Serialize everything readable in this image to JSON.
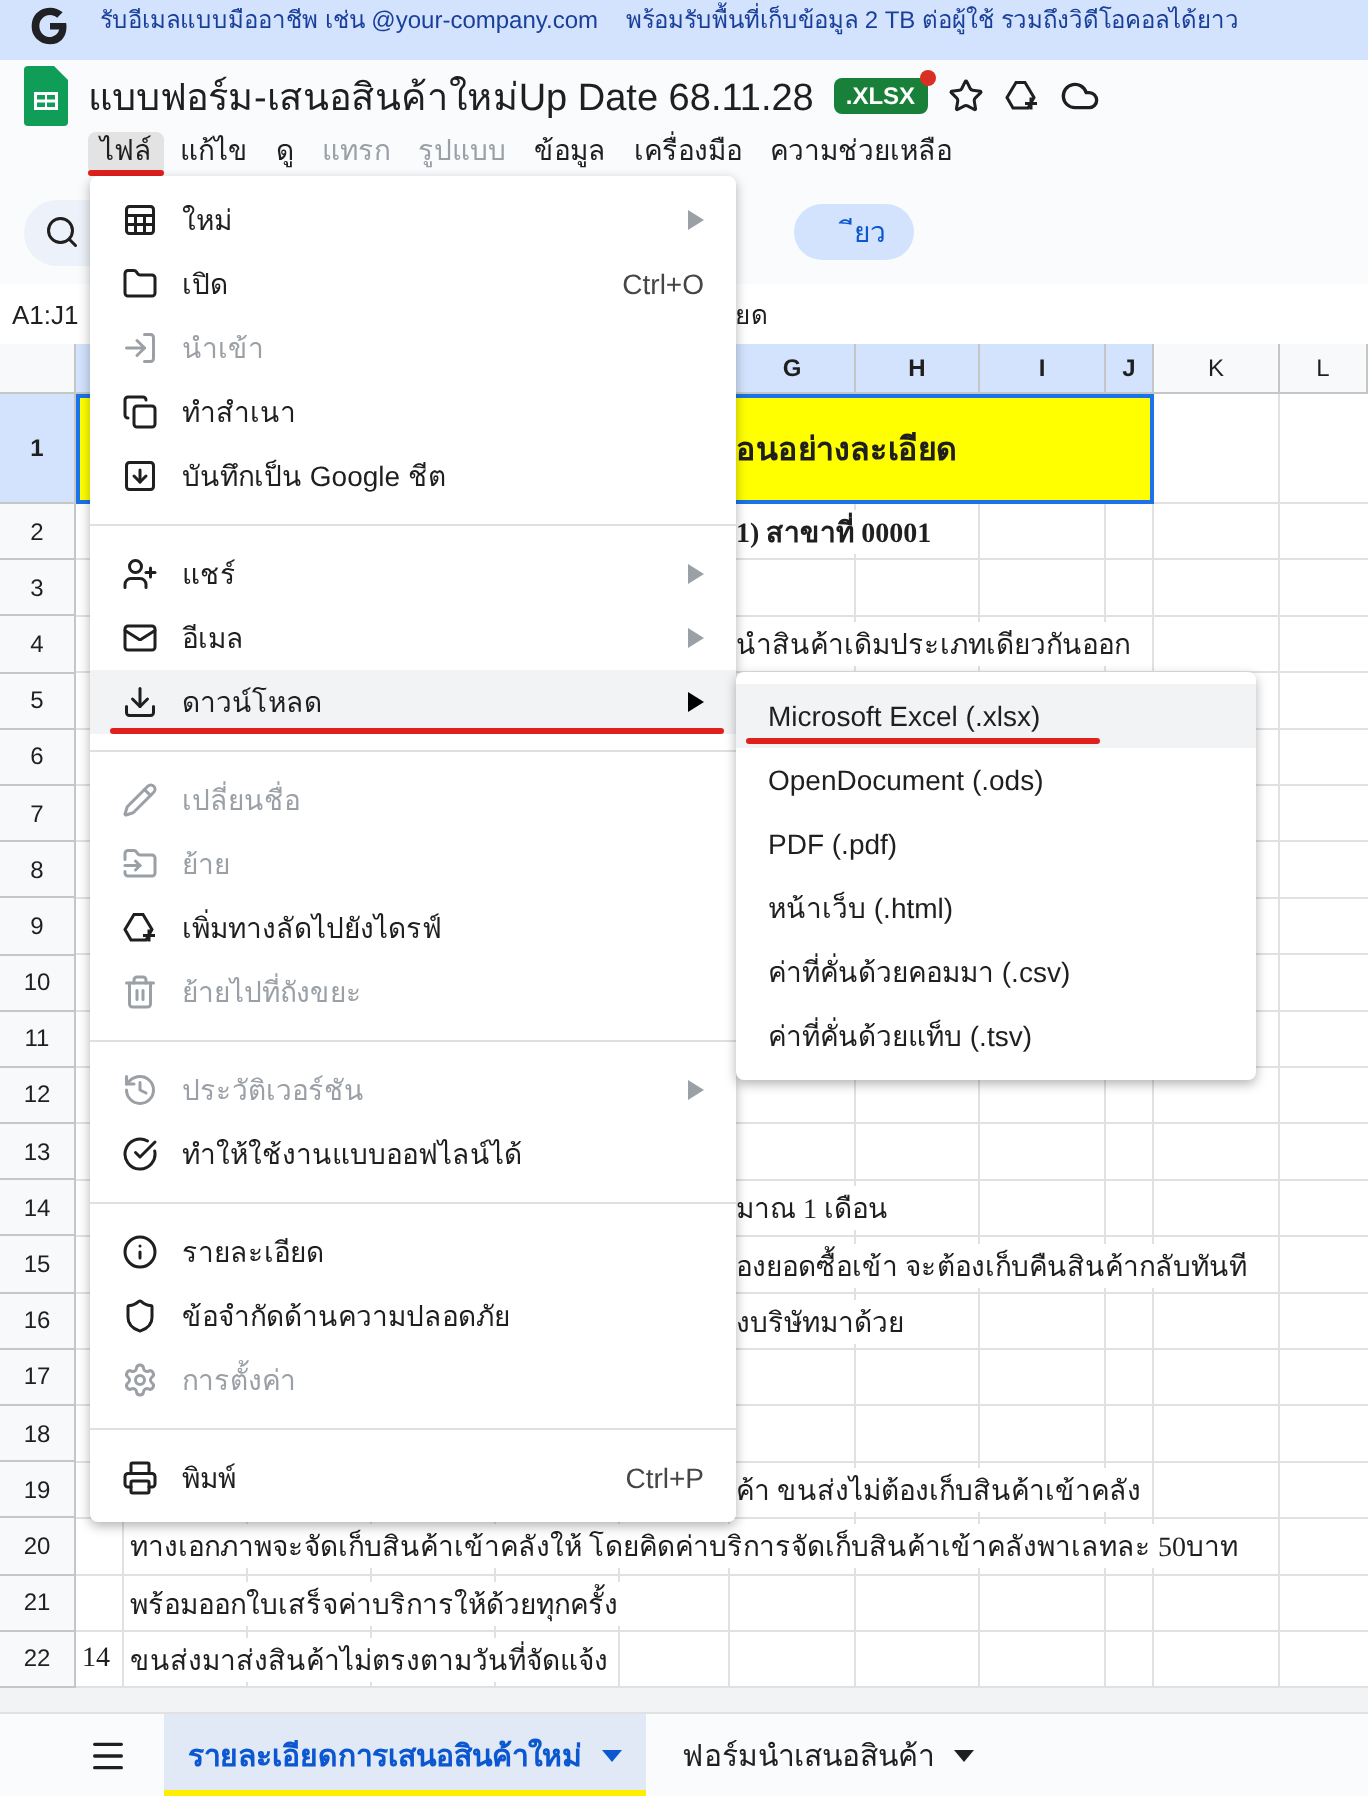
{
  "banner": {
    "texts": [
      "รับอีเมลแบบมืออาชีพ เช่น  @your-company.com",
      "พร้อมรับพื้นที่เก็บข้อมูล 2 TB ต่อผู้ใช้ รวมถึงวิดีโอคอลได้ยาว"
    ]
  },
  "document": {
    "title": "แบบฟอร์ม-เสนอสินค้าใหม่Up Date 68.11.28",
    "badge": ".XLSX",
    "badge_dot": true
  },
  "menu_bar": [
    {
      "label": "ไฟล์",
      "selected": true,
      "disabled": false,
      "marked": true
    },
    {
      "label": "แก้ไข",
      "selected": false,
      "disabled": false,
      "marked": false
    },
    {
      "label": "ดู",
      "selected": false,
      "disabled": false,
      "marked": false
    },
    {
      "label": "แทรก",
      "selected": false,
      "disabled": true,
      "marked": false
    },
    {
      "label": "รูปแบบ",
      "selected": false,
      "disabled": true,
      "marked": false
    },
    {
      "label": "ข้อมูล",
      "selected": false,
      "disabled": false,
      "marked": false
    },
    {
      "label": "เครื่องมือ",
      "selected": false,
      "disabled": false,
      "marked": false
    },
    {
      "label": "ความช่วยเหลือ",
      "selected": false,
      "disabled": false,
      "marked": false
    }
  ],
  "toolbar": {
    "button_text": "ียว"
  },
  "formula_bar": {
    "name_box": "A1:J1",
    "content": "ยด"
  },
  "sheet": {
    "columns": [
      {
        "label": "G",
        "selected": true
      },
      {
        "label": "H",
        "selected": true
      },
      {
        "label": "I",
        "selected": true
      },
      {
        "label": "J",
        "selected": true
      },
      {
        "label": "K",
        "selected": false
      },
      {
        "label": "L",
        "selected": false
      }
    ],
    "rows": [
      {
        "number": "1",
        "selected": true,
        "kind": "heading",
        "text": "อนอย่างละเอียด"
      },
      {
        "number": "2",
        "selected": false,
        "kind": "subheading",
        "text": "1)  สาขาที่ 00001"
      },
      {
        "number": "3",
        "selected": false
      },
      {
        "number": "4",
        "selected": false,
        "kind": "tail",
        "text": "นำสินค้าเดิมประเภทเดียวกันออก"
      },
      {
        "number": "5",
        "selected": false
      },
      {
        "number": "6",
        "selected": false
      },
      {
        "number": "7",
        "selected": false
      },
      {
        "number": "8",
        "selected": false
      },
      {
        "number": "9",
        "selected": false
      },
      {
        "number": "10",
        "selected": false
      },
      {
        "number": "11",
        "selected": false
      },
      {
        "number": "12",
        "selected": false
      },
      {
        "number": "13",
        "selected": false
      },
      {
        "number": "14",
        "selected": false,
        "kind": "tail",
        "text": "มาณ  1 เดือน"
      },
      {
        "number": "15",
        "selected": false,
        "kind": "tail",
        "text": "องยอดซื้อเข้า  จะต้องเก็บคืนสินค้ากลับทันที"
      },
      {
        "number": "16",
        "selected": false,
        "kind": "tail",
        "text": "งบริษัทมาด้วย"
      },
      {
        "number": "17",
        "selected": false
      },
      {
        "number": "18",
        "selected": false
      },
      {
        "number": "19",
        "selected": false,
        "kind": "tail",
        "text": "ค้า  ขนส่งไม่ต้องเก็บสินค้าเข้าคลัง"
      },
      {
        "number": "20",
        "selected": false,
        "kind": "line",
        "text": "ทางเอกภาพจะจัดเก็บสินค้าเข้าคลังให้   โดยคิดค่าบริการจัดเก็บสินค้าเข้าคลังพาเลทละ  50บาท"
      },
      {
        "number": "21",
        "selected": false,
        "kind": "line",
        "text": "พร้อมออกใบเสร็จค่าบริการให้ด้วยทุกครั้ง"
      },
      {
        "number": "22",
        "selected": false,
        "kind": "line",
        "index": "14",
        "text": "ขนส่งมาส่งสินค้าไม่ตรงตามวันที่จัดแจ้ง"
      }
    ]
  },
  "file_menu": {
    "sections": [
      {
        "items": [
          {
            "label": "ใหม่",
            "submenu": true,
            "disabled": false,
            "highlighted": false,
            "marked": false
          },
          {
            "label": "เปิด",
            "shortcut": "Ctrl+O",
            "submenu": false,
            "disabled": false,
            "highlighted": false,
            "marked": false
          },
          {
            "label": "นำเข้า",
            "submenu": false,
            "disabled": true,
            "highlighted": false,
            "marked": false
          },
          {
            "label": "ทำสำเนา",
            "submenu": false,
            "disabled": false,
            "highlighted": false,
            "marked": false
          },
          {
            "label": "บันทึกเป็น Google ชีต",
            "submenu": false,
            "disabled": false,
            "highlighted": false,
            "marked": false
          }
        ]
      },
      {
        "items": [
          {
            "label": "แชร์",
            "submenu": true,
            "disabled": false,
            "highlighted": false,
            "marked": false
          },
          {
            "label": "อีเมล",
            "submenu": true,
            "disabled": false,
            "highlighted": false,
            "marked": false
          },
          {
            "label": "ดาวน์โหลด",
            "submenu": true,
            "disabled": false,
            "highlighted": true,
            "marked": true
          }
        ]
      },
      {
        "items": [
          {
            "label": "เปลี่ยนชื่อ",
            "submenu": false,
            "disabled": true,
            "highlighted": false,
            "marked": false
          },
          {
            "label": "ย้าย",
            "submenu": false,
            "disabled": true,
            "highlighted": false,
            "marked": false
          },
          {
            "label": "เพิ่มทางลัดไปยังไดรฟ์",
            "submenu": false,
            "disabled": false,
            "highlighted": false,
            "marked": false
          },
          {
            "label": "ย้ายไปที่ถังขยะ",
            "submenu": false,
            "disabled": true,
            "highlighted": false,
            "marked": false
          }
        ]
      },
      {
        "items": [
          {
            "label": "ประวัติเวอร์ชัน",
            "submenu": true,
            "disabled": true,
            "highlighted": false,
            "marked": false
          },
          {
            "label": "ทำให้ใช้งานแบบออฟไลน์ได้",
            "submenu": false,
            "disabled": false,
            "highlighted": false,
            "marked": false
          }
        ]
      },
      {
        "items": [
          {
            "label": "รายละเอียด",
            "submenu": false,
            "disabled": false,
            "highlighted": false,
            "marked": false
          },
          {
            "label": "ข้อจำกัดด้านความปลอดภัย",
            "submenu": false,
            "disabled": false,
            "highlighted": false,
            "marked": false
          },
          {
            "label": "การตั้งค่า",
            "submenu": false,
            "disabled": true,
            "highlighted": false,
            "marked": false
          }
        ]
      },
      {
        "items": [
          {
            "label": "พิมพ์",
            "shortcut": "Ctrl+P",
            "submenu": false,
            "disabled": false,
            "highlighted": false,
            "marked": false
          }
        ]
      }
    ]
  },
  "download_menu": [
    {
      "label": "Microsoft Excel (.xlsx)",
      "highlighted": true,
      "marked": true
    },
    {
      "label": "OpenDocument (.ods)",
      "highlighted": false,
      "marked": false
    },
    {
      "label": "PDF (.pdf)",
      "highlighted": false,
      "marked": false
    },
    {
      "label": "หน้าเว็บ (.html)",
      "highlighted": false,
      "marked": false
    },
    {
      "label": "ค่าที่คั่นด้วยคอมมา (.csv)",
      "highlighted": false,
      "marked": false
    },
    {
      "label": "ค่าที่คั่นด้วยแท็บ (.tsv)",
      "highlighted": false,
      "marked": false
    }
  ],
  "sheet_tabs": [
    {
      "label": "รายละเอียดการเสนอสินค้าใหม่",
      "selected": true,
      "marked": true
    },
    {
      "label": "ฟอร์มนำเสนอสินค้า",
      "selected": false,
      "marked": false
    }
  ]
}
